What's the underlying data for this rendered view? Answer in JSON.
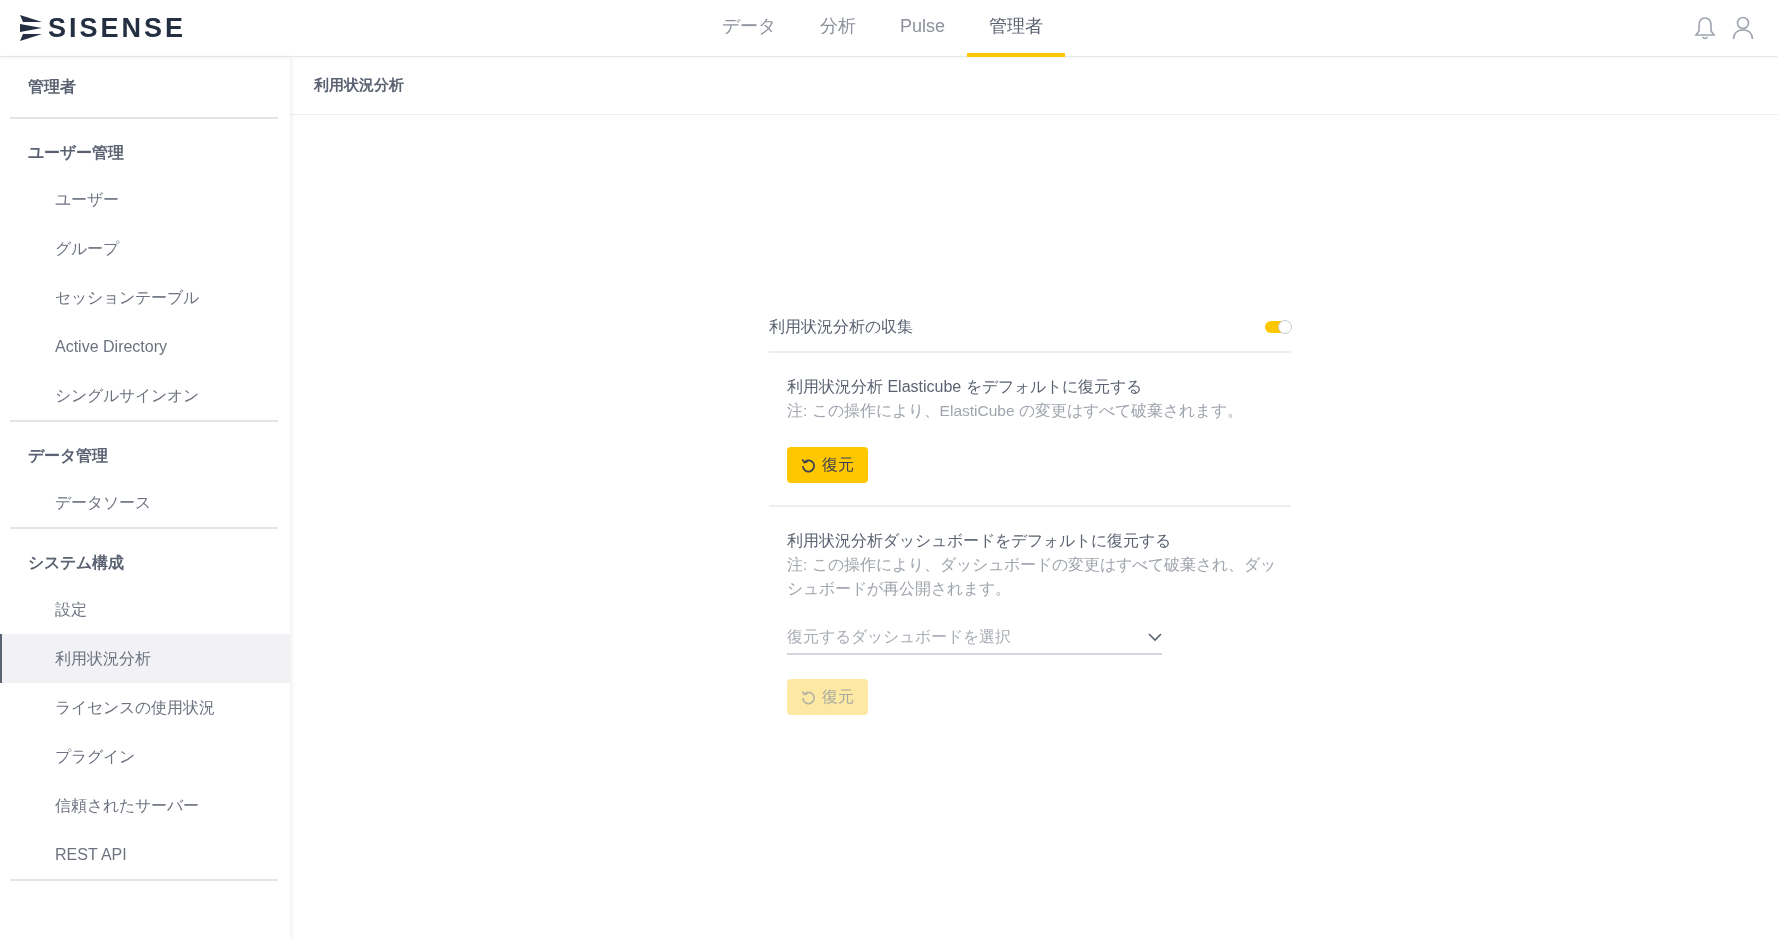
{
  "logo": {
    "text": "SISENSE"
  },
  "top_tabs": [
    {
      "label": "データ",
      "selected": false
    },
    {
      "label": "分析",
      "selected": false
    },
    {
      "label": "Pulse",
      "selected": false
    },
    {
      "label": "管理者",
      "selected": true
    }
  ],
  "sidebar": {
    "title": "管理者",
    "sections": [
      {
        "heading": "ユーザー管理",
        "items": [
          {
            "label": "ユーザー",
            "selected": false
          },
          {
            "label": "グループ",
            "selected": false
          },
          {
            "label": "セッションテーブル",
            "selected": false
          },
          {
            "label": "Active Directory",
            "selected": false
          },
          {
            "label": "シングルサインオン",
            "selected": false
          }
        ]
      },
      {
        "heading": "データ管理",
        "items": [
          {
            "label": "データソース",
            "selected": false
          }
        ]
      },
      {
        "heading": "システム構成",
        "items": [
          {
            "label": "設定",
            "selected": false
          },
          {
            "label": "利用状況分析",
            "selected": true
          },
          {
            "label": "ライセンスの使用状況",
            "selected": false
          },
          {
            "label": "プラグイン",
            "selected": false
          },
          {
            "label": "信頼されたサーバー",
            "selected": false
          },
          {
            "label": "REST API",
            "selected": false
          }
        ]
      }
    ]
  },
  "page_title": "利用状況分析",
  "collect_toggle": {
    "label": "利用状況分析の収集",
    "on": true
  },
  "restore_sections": [
    {
      "title": "利用状況分析 Elasticube をデフォルトに復元する",
      "note": "注: この操作により、ElastiCube の変更はすべて破棄されます。",
      "button": {
        "label": "復元",
        "disabled": false
      }
    },
    {
      "title": "利用状況分析ダッシュボードをデフォルトに復元する",
      "note": "注: この操作により、ダッシュボードの変更はすべて破棄され、ダッシュボードが再公開されます。",
      "select": {
        "placeholder": "復元するダッシュボードを選択"
      },
      "button": {
        "label": "復元",
        "disabled": true
      }
    }
  ]
}
